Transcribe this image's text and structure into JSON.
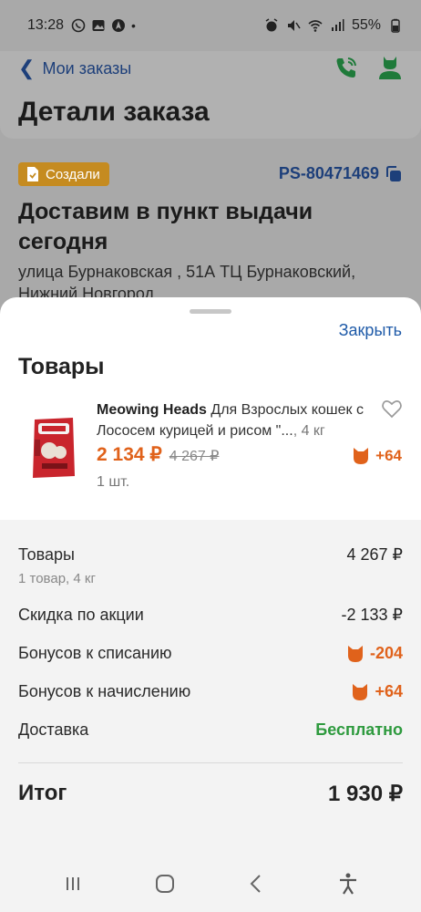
{
  "status_bar": {
    "time": "13:28",
    "battery": "55%"
  },
  "header": {
    "back_label": "Мои заказы",
    "title": "Детали заказа"
  },
  "order": {
    "status": "Создали",
    "id": "PS-80471469",
    "delivery_title": "Доставим в пункт выдачи сегодня",
    "address": "улица Бурнаковская , 51А ТЦ Бурнаковский, Нижний Новгород"
  },
  "sheet": {
    "close_label": "Закрыть",
    "title": "Товары",
    "product": {
      "brand": "Meowing Heads",
      "name": " Для Взрослых кошек с Лососем курицей и рисом \"...",
      "weight": ", 4 кг",
      "price": "2 134 ₽",
      "old_price": "4 267 ₽",
      "bonus": "+64",
      "quantity": "1 шт."
    },
    "summary": {
      "goods_label": "Товары",
      "goods_value": "4 267 ₽",
      "goods_sub": "1 товар, 4 кг",
      "discount_label": "Скидка по акции",
      "discount_value": "-2 133 ₽",
      "bonus_spend_label": "Бонусов к списанию",
      "bonus_spend_value": "-204",
      "bonus_earn_label": "Бонусов к начислению",
      "bonus_earn_value": "+64",
      "delivery_label": "Доставка",
      "delivery_value": "Бесплатно",
      "total_label": "Итог",
      "total_value": "1 930 ₽"
    }
  },
  "colors": {
    "accent_blue": "#1e5aa8",
    "orange": "#e0621b",
    "green": "#2e9a3e",
    "status_chip": "#c58b20"
  },
  "icons": [
    "phone-icon",
    "user-icon",
    "copy-icon",
    "heart-icon",
    "cat-bonus-icon",
    "recents-icon",
    "home-icon",
    "back-icon",
    "accessibility-icon"
  ]
}
